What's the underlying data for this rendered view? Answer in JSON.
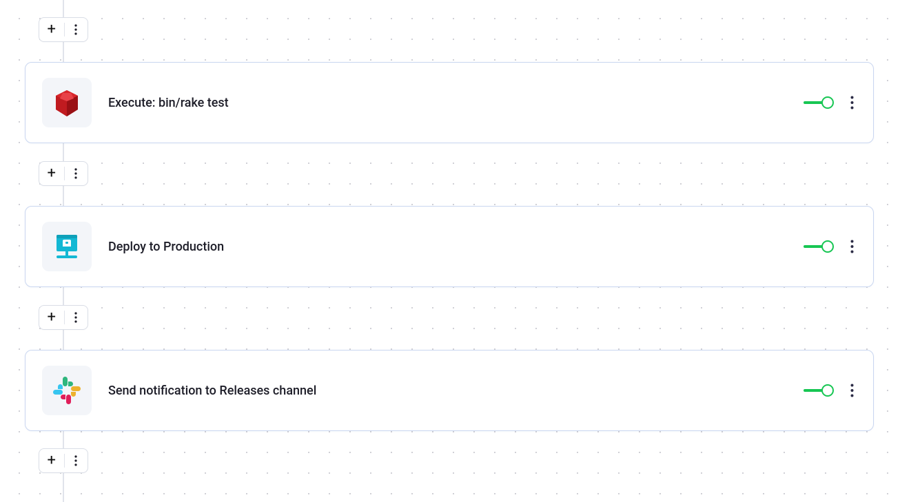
{
  "steps": [
    {
      "icon": "ruby",
      "title": "Execute: bin/rake test",
      "enabled": true
    },
    {
      "icon": "deploy",
      "title": "Deploy to Production",
      "enabled": true
    },
    {
      "icon": "slack",
      "title": "Send notification to Releases channel",
      "enabled": true
    }
  ],
  "colors": {
    "toggle_on": "#17c653",
    "card_border": "#c9d6f0"
  }
}
